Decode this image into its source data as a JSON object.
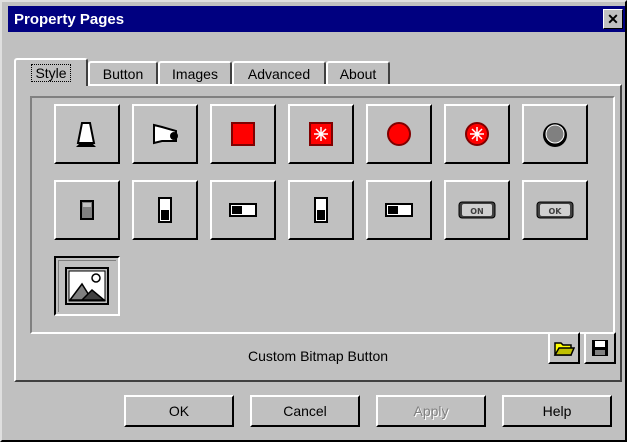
{
  "window": {
    "title": "Property Pages",
    "close_glyph": "✕"
  },
  "tabs": [
    {
      "label": "Style",
      "active": true
    },
    {
      "label": "Button",
      "active": false
    },
    {
      "label": "Images",
      "active": false
    },
    {
      "label": "Advanced",
      "active": false
    },
    {
      "label": "About",
      "active": false
    }
  ],
  "styles": {
    "row1": [
      "bell-icon",
      "speaker-icon",
      "red-square-icon",
      "red-burst-square-icon",
      "red-circle-icon",
      "red-burst-circle-icon",
      "knob-icon"
    ],
    "row2": [
      "trash-bin-icon",
      "vertical-switch-up-icon",
      "horizontal-switch-left-icon",
      "vertical-switch-down-icon",
      "horizontal-switch-right-icon",
      "on-button-icon",
      "ok-button-icon"
    ],
    "row3": [
      "picture-icon"
    ],
    "selected": "picture-icon",
    "on_text": "ON",
    "ok_text": "OK"
  },
  "style_label": "Custom Bitmap Button",
  "tools": {
    "open": "open-folder-icon",
    "save": "save-disk-icon"
  },
  "buttons": {
    "ok": "OK",
    "cancel": "Cancel",
    "apply": "Apply",
    "help": "Help"
  },
  "colors": {
    "title_bar": "#000080",
    "face": "#c0c0c0",
    "red": "#ff0000"
  }
}
